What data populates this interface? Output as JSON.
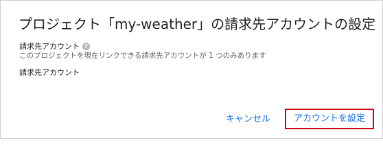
{
  "dialog": {
    "title": "プロジェクト「my-weather」の請求先アカウントの設定",
    "account_label": "請求先アカウント",
    "help_icon_glyph": "?",
    "helper_text": "このプロジェクトを現在リンクできる請求先アカウントが 1 つのみあります",
    "billing_account_value_label": "請求先アカウント"
  },
  "actions": {
    "cancel_label": "キャンセル",
    "set_account_label": "アカウントを設定"
  },
  "colors": {
    "link_blue": "#1a73e8",
    "highlight_red": "#d0021b"
  },
  "icons": {
    "help": "help-circle-icon"
  }
}
